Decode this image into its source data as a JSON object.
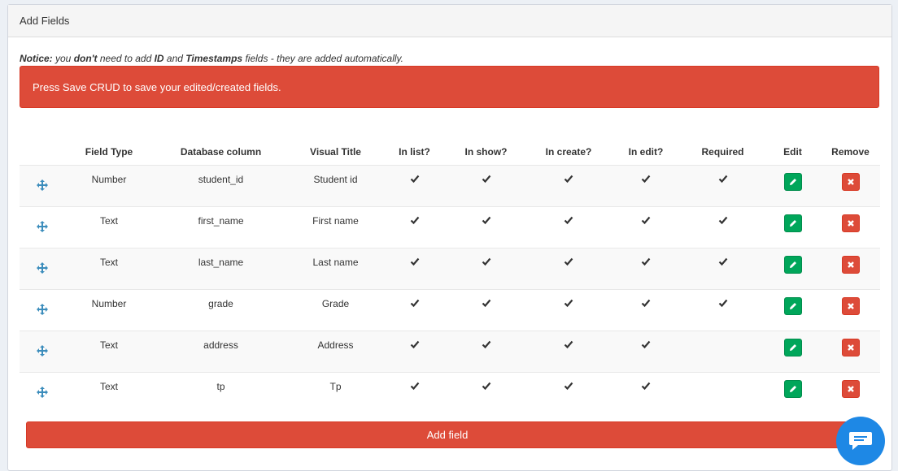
{
  "panel": {
    "title": "Add Fields"
  },
  "notice": {
    "label": "Notice:",
    "part1": " you ",
    "dont": "don't",
    "part2": " need to add ",
    "id": "ID",
    "and": " and ",
    "timestamps": "Timestamps",
    "part3": " fields - they are added automatically."
  },
  "alert": {
    "text": "Press Save CRUD to save your edited/created fields."
  },
  "table": {
    "headers": [
      "",
      "Field Type",
      "Database column",
      "Visual Title",
      "In list?",
      "In show?",
      "In create?",
      "In edit?",
      "Required",
      "Edit",
      "Remove"
    ],
    "rows": [
      {
        "type": "Number",
        "column": "student_id",
        "title": "Student id",
        "in_list": true,
        "in_show": true,
        "in_create": true,
        "in_edit": true,
        "required": true
      },
      {
        "type": "Text",
        "column": "first_name",
        "title": "First name",
        "in_list": true,
        "in_show": true,
        "in_create": true,
        "in_edit": true,
        "required": true
      },
      {
        "type": "Text",
        "column": "last_name",
        "title": "Last name",
        "in_list": true,
        "in_show": true,
        "in_create": true,
        "in_edit": true,
        "required": true
      },
      {
        "type": "Number",
        "column": "grade",
        "title": "Grade",
        "in_list": true,
        "in_show": true,
        "in_create": true,
        "in_edit": true,
        "required": true
      },
      {
        "type": "Text",
        "column": "address",
        "title": "Address",
        "in_list": true,
        "in_show": true,
        "in_create": true,
        "in_edit": true,
        "required": false
      },
      {
        "type": "Text",
        "column": "tp",
        "title": "Tp",
        "in_list": true,
        "in_show": true,
        "in_create": true,
        "in_edit": true,
        "required": false
      }
    ]
  },
  "buttons": {
    "add_field": "Add field"
  },
  "icons": {
    "drag": "move-arrows-icon",
    "check": "check-icon",
    "edit": "pencil-icon",
    "remove": "times-icon",
    "chat": "chat-bubble-icon"
  },
  "colors": {
    "danger": "#dd4b39",
    "success": "#00a65a",
    "drag_icon": "#3c8dbc",
    "chat": "#1e88e5"
  }
}
